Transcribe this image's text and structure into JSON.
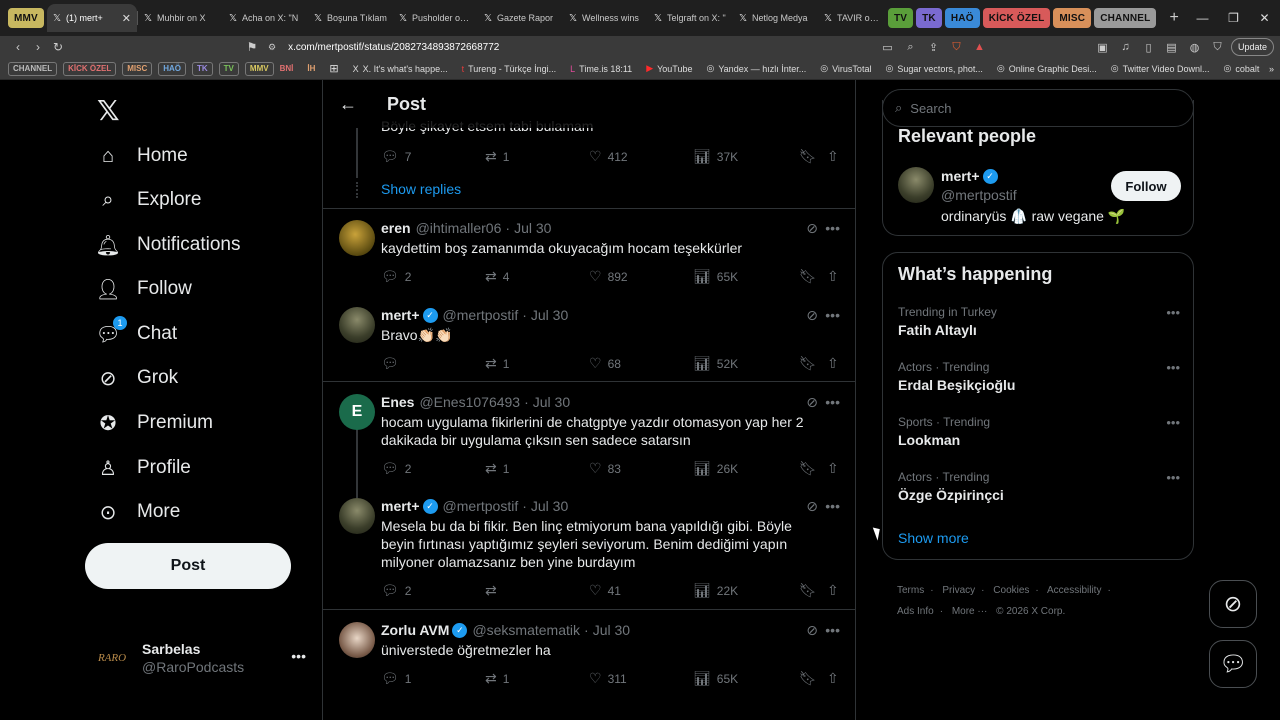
{
  "browser": {
    "tab_groups_left": [
      {
        "label": "MMV",
        "color": "#c8b860"
      }
    ],
    "tabs": [
      {
        "title": "(1) mert+",
        "active": true
      },
      {
        "title": "Muhbir on X"
      },
      {
        "title": "Acha on X: \"N"
      },
      {
        "title": "Boşuna Tıklam"
      },
      {
        "title": "Pusholder on X"
      },
      {
        "title": "Gazete Rapor"
      },
      {
        "title": "Wellness wins"
      },
      {
        "title": "Telgraft on X: \""
      },
      {
        "title": "Netlog Medya"
      },
      {
        "title": "TAVIR on X: \"K"
      }
    ],
    "tab_groups_right": [
      {
        "label": "TV",
        "color": "#5a9e3a"
      },
      {
        "label": "TK",
        "color": "#7a6ad0"
      },
      {
        "label": "HAÖ",
        "color": "#3a8ad8"
      },
      {
        "label": "KİCK ÖZEL",
        "color": "#d85a5a"
      },
      {
        "label": "MISC",
        "color": "#d8905a"
      },
      {
        "label": "CHANNEL",
        "color": "#9a9a9a"
      }
    ],
    "url": "x.com/mertpostif/status/2082734893872668772",
    "update_label": "Update",
    "bookmark_folders": [
      {
        "label": "CHANNEL",
        "color": "#bbbbbb"
      },
      {
        "label": "KİCK ÖZEL",
        "color": "#e07070"
      },
      {
        "label": "MISC",
        "color": "#e0a070"
      },
      {
        "label": "HAÖ",
        "color": "#70a8e0"
      },
      {
        "label": "TK",
        "color": "#9a8ae0"
      },
      {
        "label": "TV",
        "color": "#7ac05a"
      },
      {
        "label": "MMV",
        "color": "#d8c860"
      },
      {
        "label": "BNİ",
        "color": "#e07070"
      },
      {
        "label": "İH",
        "color": "#e0a070"
      }
    ],
    "bookmarks": [
      {
        "label": "X. It's what's happe...",
        "icon": "X"
      },
      {
        "label": "Tureng - Türkçe İngi...",
        "icon": "t"
      },
      {
        "label": "Time.is 18:11",
        "icon": "L"
      },
      {
        "label": "YouTube",
        "icon": "▶"
      },
      {
        "label": "Yandex — hızlı İnter...",
        "icon": "◎"
      },
      {
        "label": "VirusTotal",
        "icon": "◎"
      },
      {
        "label": "Sugar vectors, phot...",
        "icon": "◎"
      },
      {
        "label": "Online Graphic Desi...",
        "icon": "◎"
      },
      {
        "label": "Twitter Video Downl...",
        "icon": "◎"
      },
      {
        "label": "cobalt",
        "icon": "◎"
      }
    ]
  },
  "nav": {
    "items": [
      {
        "label": "Home",
        "icon": "home-icon"
      },
      {
        "label": "Explore",
        "icon": "search-icon"
      },
      {
        "label": "Notifications",
        "icon": "bell-icon"
      },
      {
        "label": "Follow",
        "icon": "person-plus-icon"
      },
      {
        "label": "Chat",
        "icon": "chat-icon",
        "badge": "1"
      },
      {
        "label": "Grok",
        "icon": "grok-icon"
      },
      {
        "label": "Premium",
        "icon": "verified-icon"
      },
      {
        "label": "Profile",
        "icon": "person-icon"
      },
      {
        "label": "More",
        "icon": "more-circle-icon"
      }
    ],
    "post_label": "Post",
    "account": {
      "name": "Sarbelas",
      "handle": "@RaroPodcasts",
      "avatar_text": "RARO"
    }
  },
  "main": {
    "header_title": "Post",
    "peek_text": "Böyle şikayet etsem tabi bulamam",
    "peek_actions": {
      "replies": "7",
      "reposts": "1",
      "likes": "412",
      "views": "37K"
    },
    "show_replies": "Show replies",
    "replies": [
      {
        "name": "eren",
        "handle": "@ihtimaller06",
        "date": "Jul 30",
        "verified": false,
        "text": "kaydettim boş zamanımda okuyacağım hocam teşekkürler",
        "replies": "2",
        "reposts": "4",
        "likes": "892",
        "views": "65K"
      },
      {
        "name": "mert+",
        "handle": "@mertpostif",
        "date": "Jul 30",
        "verified": true,
        "text": "Bravo👏🏻👏🏻",
        "replies": "",
        "reposts": "1",
        "likes": "68",
        "views": "52K"
      },
      {
        "name": "Enes",
        "handle": "@Enes1076493",
        "date": "Jul 30",
        "verified": false,
        "avatar_letter": "E",
        "text": "hocam uygulama fikirlerini de chatgptye yazdır otomasyon yap her 2 dakikada bir uygulama çıksın sen sadece satarsın",
        "replies": "2",
        "reposts": "1",
        "likes": "83",
        "views": "26K"
      },
      {
        "name": "mert+",
        "handle": "@mertpostif",
        "date": "Jul 30",
        "verified": true,
        "text": "Mesela bu da bi fikir. Ben linç etmiyorum bana yapıldığı gibi. Böyle beyin fırtınası yaptığımız şeyleri seviyorum. Benim dediğimi yapın milyoner olamazsanız ben yine burdayım",
        "replies": "2",
        "reposts": "",
        "likes": "41",
        "views": "22K"
      },
      {
        "name": "Zorlu AVM",
        "handle": "@seksmatematik",
        "date": "Jul 30",
        "verified": true,
        "text": "üniverstede öğretmezler ha",
        "replies": "1",
        "reposts": "1",
        "likes": "311",
        "views": "65K"
      }
    ]
  },
  "sidebar": {
    "search_placeholder": "Search",
    "relevant_title": "Relevant people",
    "relevant_person": {
      "name": "mert+",
      "handle": "@mertpostif",
      "bio": "ordinaryüs 🥼 raw vegane 🌱",
      "follow_label": "Follow"
    },
    "happening_title": "What’s happening",
    "trends": [
      {
        "meta": "Trending in Turkey",
        "name": "Fatih Altaylı"
      },
      {
        "meta": "Actors · Trending",
        "name": "Erdal Beşikçioğlu"
      },
      {
        "meta": "Sports · Trending",
        "name": "Lookman"
      },
      {
        "meta": "Actors · Trending",
        "name": "Özge Özpirinçci"
      }
    ],
    "show_more": "Show more",
    "footer_links": [
      "Terms",
      "·",
      "Privacy",
      "·",
      "Cookies",
      "·",
      "Accessibility",
      "·",
      "Ads Info",
      "·",
      "More ···",
      "© 2026 X Corp."
    ]
  }
}
